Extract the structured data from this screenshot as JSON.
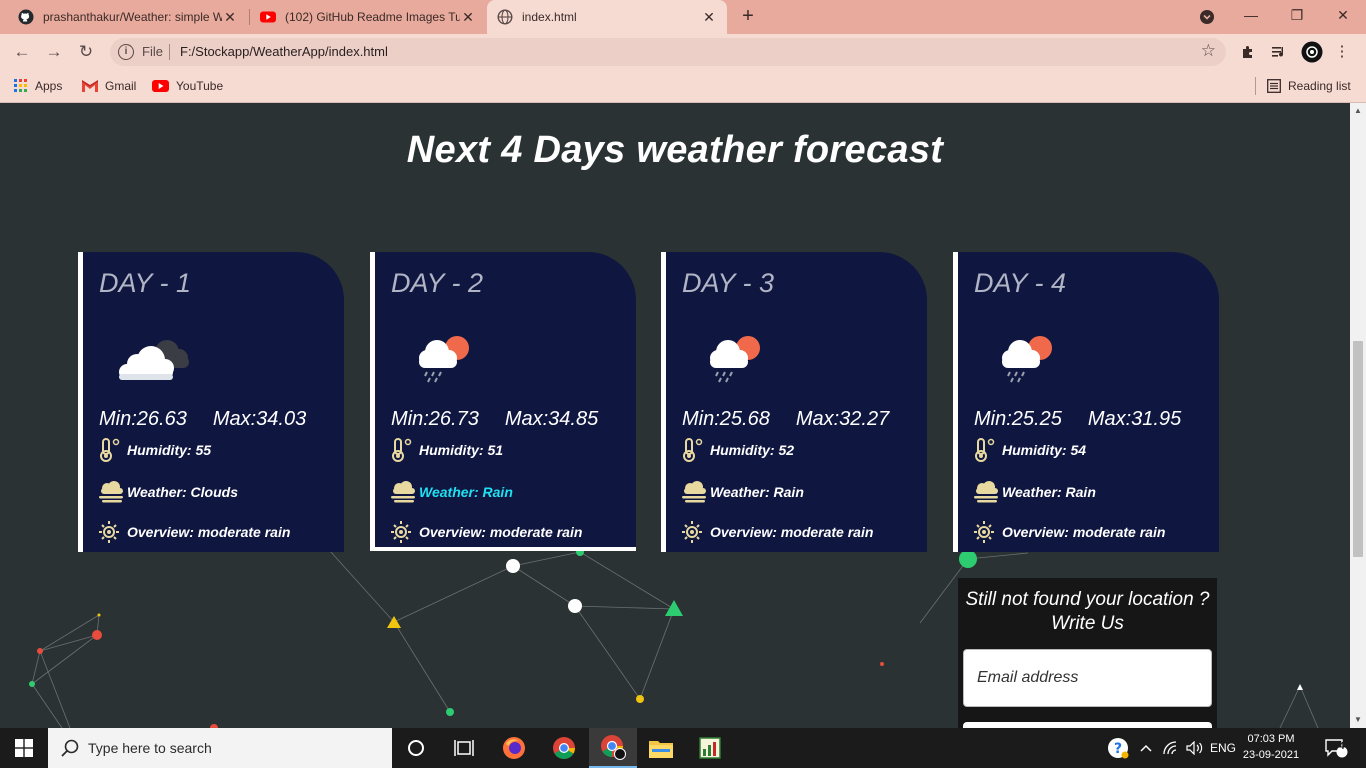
{
  "browser": {
    "tabs": [
      {
        "label": "prashanthakur/Weather: simple W",
        "icon": "github-icon"
      },
      {
        "label": "(102) GitHub Readme Images Tut",
        "icon": "youtube-icon"
      },
      {
        "label": "index.html",
        "icon": "globe-icon"
      }
    ],
    "address": {
      "scheme_label": "File",
      "url": "F:/Stockapp/WeatherApp/index.html"
    },
    "bookmarks": [
      {
        "label": "Apps",
        "icon": "apps-grid-icon"
      },
      {
        "label": "Gmail",
        "icon": "gmail-icon"
      },
      {
        "label": "YouTube",
        "icon": "youtube-icon"
      }
    ],
    "reading_list": "Reading list"
  },
  "page": {
    "title": "Next 4 Days weather forecast",
    "days": [
      {
        "day": "DAY - 1",
        "min": "Min:26.63",
        "max": "Max:34.03",
        "humidity": "Humidity: 55",
        "weather": "Weather: Clouds",
        "overview": "Overview: moderate rain",
        "icon": "broken-clouds-icon"
      },
      {
        "day": "DAY - 2",
        "min": "Min:26.73",
        "max": "Max:34.85",
        "humidity": "Humidity: 51",
        "weather": "Weather: Rain",
        "overview": "Overview: moderate rain",
        "icon": "rain-sun-cloud-icon"
      },
      {
        "day": "DAY - 3",
        "min": "Min:25.68",
        "max": "Max:32.27",
        "humidity": "Humidity: 52",
        "weather": "Weather: Rain",
        "overview": "Overview: moderate rain",
        "icon": "rain-sun-cloud-icon"
      },
      {
        "day": "DAY - 4",
        "min": "Min:25.25",
        "max": "Max:31.95",
        "humidity": "Humidity: 54",
        "weather": "Weather: Rain",
        "overview": "Overview: moderate rain",
        "icon": "rain-sun-cloud-icon"
      }
    ],
    "contact": {
      "title": "Still not found your location ? Write Us",
      "email_placeholder": "Email address"
    }
  },
  "taskbar": {
    "search_placeholder": "Type here to search",
    "language": "ENG",
    "time": "07:03 PM",
    "date": "23-09-2021",
    "notification_count": "4"
  },
  "colors": {
    "card_bg": "#0f1640",
    "page_bg": "#2b3233",
    "highlight_text": "#1fe0f0",
    "tabbar": "#e8aa9c"
  }
}
